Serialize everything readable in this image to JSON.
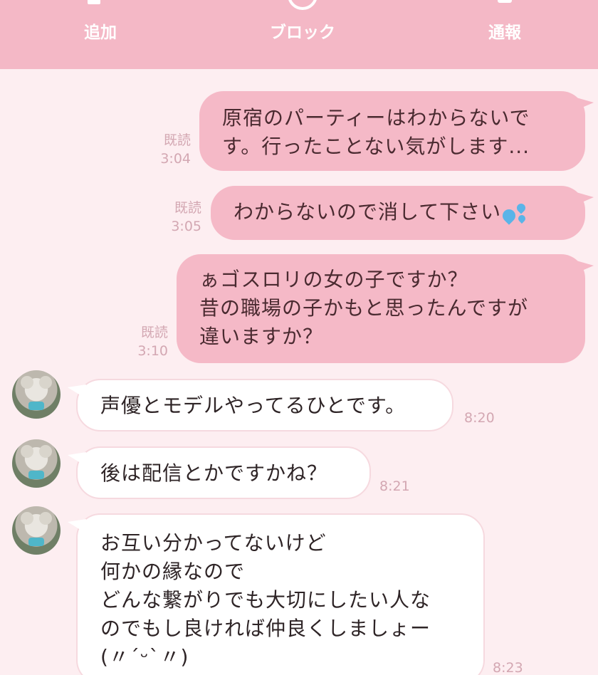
{
  "header": {
    "add_label": "追加",
    "block_label": "ブロック",
    "report_label": "通報"
  },
  "messages_out": [
    {
      "read_label": "既読",
      "time": "3:04",
      "lines": [
        "原宿のパーティーはわからないで",
        "す。行ったことない気がします..."
      ]
    },
    {
      "read_label": "既読",
      "time": "3:05",
      "text": "わからないので消して下さい",
      "emoji": "sweat-droplets-icon"
    },
    {
      "read_label": "既読",
      "time": "3:10",
      "lines": [
        "ぁゴスロリの女の子ですか？",
        "昔の職場の子かもと思ったんですが",
        "違いますか？"
      ]
    }
  ],
  "messages_in": [
    {
      "time": "8:20",
      "lines": [
        "声優とモデルやってるひとです。"
      ]
    },
    {
      "time": "8:21",
      "lines": [
        "後は配信とかですかね？"
      ]
    },
    {
      "time": "8:23",
      "lines": [
        "お互い分かってないけど",
        "何かの縁なので",
        "どんな繋がりでも大切にしたい人な",
        "のでもし良ければ仲良くしましょー",
        "(〃ˊᵕˋ〃)"
      ]
    }
  ],
  "colors": {
    "header_bg": "#f4b8c6",
    "chat_bg": "#fdeef1",
    "outgoing_bubble": "#f5b9c7",
    "incoming_bubble": "#ffffff",
    "meta_text": "#d3a7b2"
  }
}
